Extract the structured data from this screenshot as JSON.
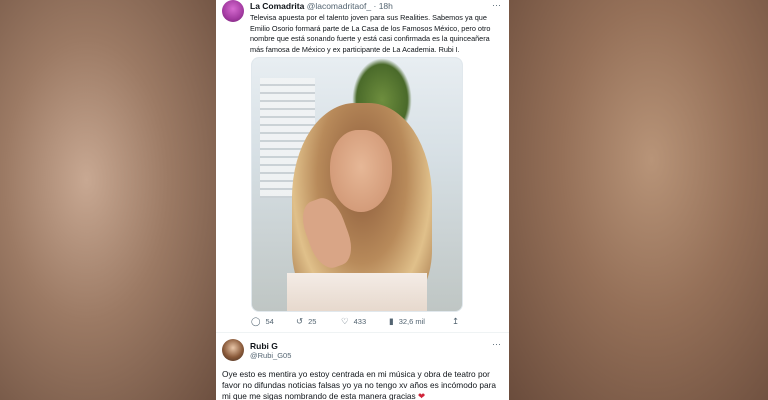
{
  "tweet": {
    "name": "La Comadrita",
    "handle": "@lacomadritaof_",
    "time": "18h",
    "text": "Televisa apuesta por el talento joven para sus Realities. Sabemos ya que Emilio Osorio formará parte de La Casa de los Famosos México, pero otro nombre que está sonando fuerte y está casi confirmada es la quinceañera más famosa de México y ex participante de La Academia. Rubi I.",
    "more_icon": "···",
    "stats": {
      "replies": "54",
      "retweets": "25",
      "likes": "433",
      "views": "32,6 mil"
    }
  },
  "reply": {
    "name": "Rubi G",
    "handle": "@Rubi_G05",
    "more_icon": "···",
    "text": "Oye esto es mentira yo estoy centrada en mi música y obra de teatro por favor no difundas noticias falsas yo ya no tengo xv años es incómodo para mi que me sigas nombrando de esta manera gracias",
    "heart": "❤"
  }
}
